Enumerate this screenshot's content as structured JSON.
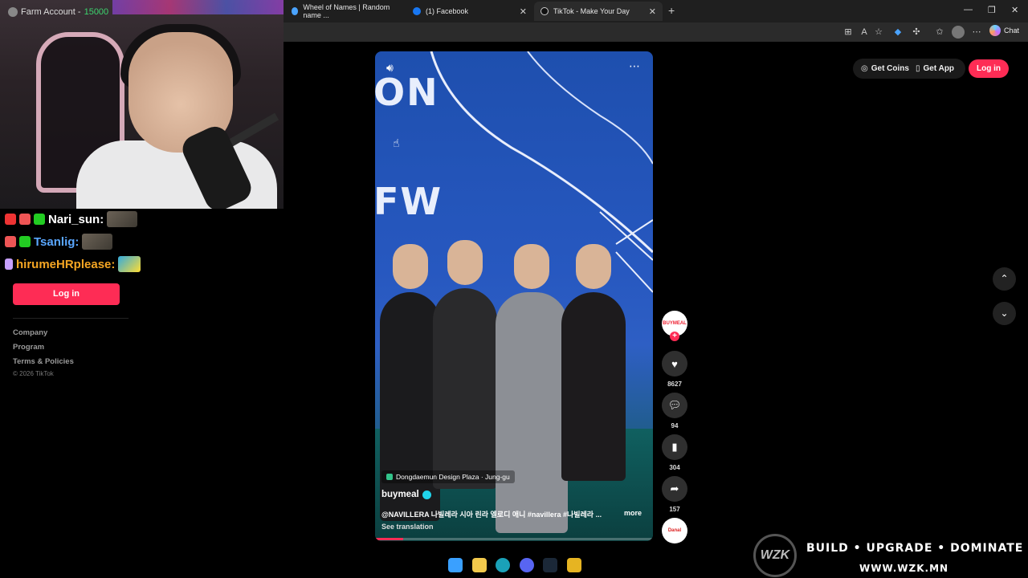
{
  "browser": {
    "tabs": [
      {
        "label": "Wheel of Names | Random name ..."
      },
      {
        "label": "(1) Facebook"
      },
      {
        "label": "TikTok - Make Your Day"
      }
    ],
    "chat_label": "Chat"
  },
  "stream": {
    "webcam_title": "Farm Account -",
    "coins": "15000"
  },
  "chat": [
    {
      "user": "Nari_sun:",
      "color": "#ffffff"
    },
    {
      "user": "Tsanlig:",
      "color": "#5aa7ff"
    },
    {
      "user": "hirumeHRplease:",
      "color": "#f5a623"
    }
  ],
  "sidebar": {
    "login_label": "Log in",
    "links": [
      "Company",
      "Program",
      "Terms & Policies"
    ],
    "copyright": "© 2026 TikTok"
  },
  "video": {
    "wall_text_1": "ON",
    "wall_text_2": "FW",
    "location": "Dongdaemun Design Plaza · Jung-gu",
    "author": "buymeal",
    "caption": "@NAVILLERA 나빌레라 시아 린라 엘로디 애니 #navillera #나빌레라 ...",
    "more": "more",
    "see_translation": "See translation",
    "progress": 0.1
  },
  "actions": {
    "avatar_text": "BUYMEAL",
    "likes": "8627",
    "comments": "94",
    "saves": "304",
    "shares": "157",
    "music_text": "Danal"
  },
  "topbar": {
    "get_coins": "Get Coins",
    "get_app": "Get App",
    "login": "Log in"
  },
  "banner": {
    "logo": "WZK",
    "slogan": "BUILD • UPGRADE • DOMINATE",
    "site": "WWW.WZK.MN"
  }
}
